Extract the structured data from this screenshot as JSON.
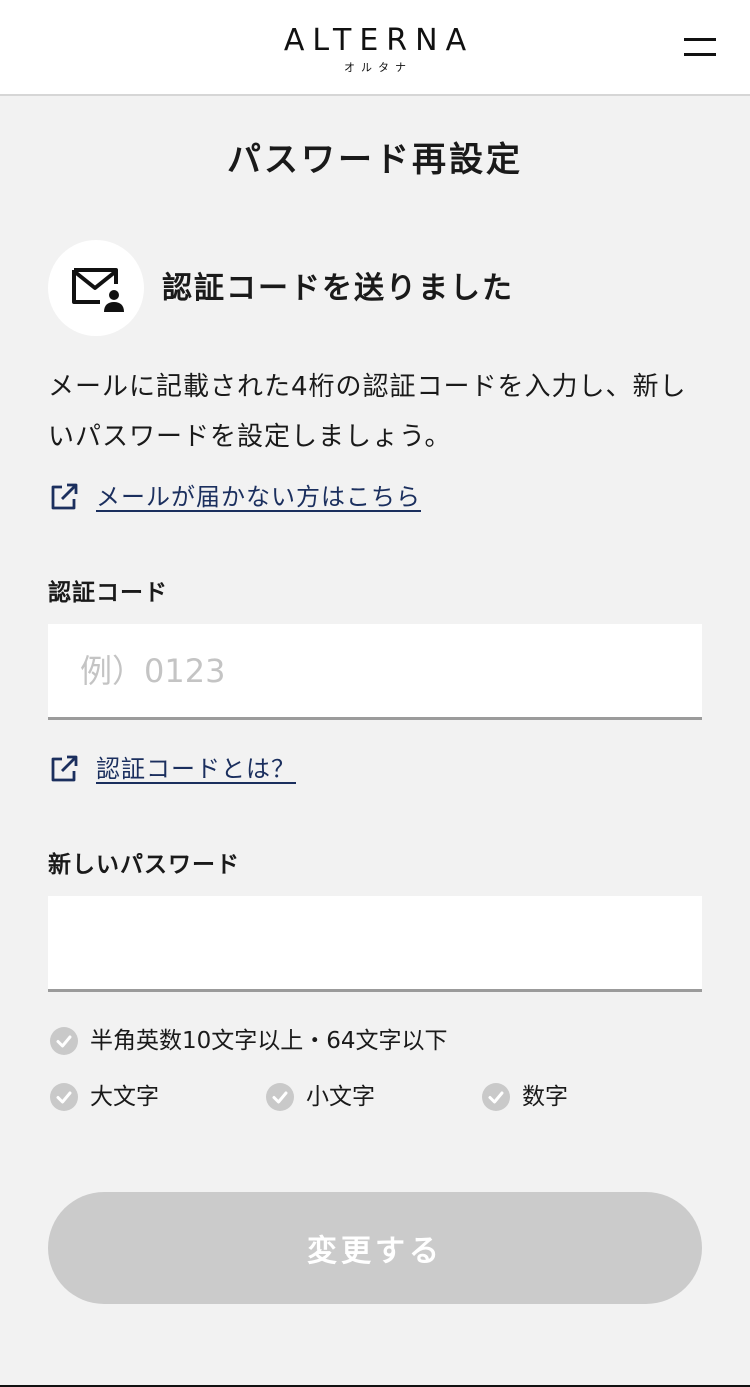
{
  "header": {
    "logo_main": "ALTERNA",
    "logo_sub": "オルタナ",
    "menu_icon": "hamburger-icon"
  },
  "page": {
    "title": "パスワード再設定"
  },
  "notice": {
    "icon": "mail-user-icon",
    "heading": "認証コードを送りました",
    "body": "メールに記載された4桁の認証コードを入力し、新しいパスワードを設定しましょう。",
    "link_text": "メールが届かない方はこちら",
    "link_icon": "external-link-icon"
  },
  "code_field": {
    "label": "認証コード",
    "placeholder": "例）0123",
    "value": "",
    "help_link": "認証コードとは？",
    "help_icon": "external-link-icon"
  },
  "password_field": {
    "label": "新しいパスワード",
    "value": ""
  },
  "rules": {
    "length": "半角英数10文字以上・64文字以下",
    "uppercase": "大文字",
    "lowercase": "小文字",
    "digits": "数字",
    "check_icon": "check-circle-icon",
    "check_color": "#c9c9c9"
  },
  "submit": {
    "label": "変更する",
    "enabled": false,
    "color": "#cbcbcb"
  },
  "colors": {
    "link": "#1b2f5e",
    "background": "#f2f2f2"
  }
}
